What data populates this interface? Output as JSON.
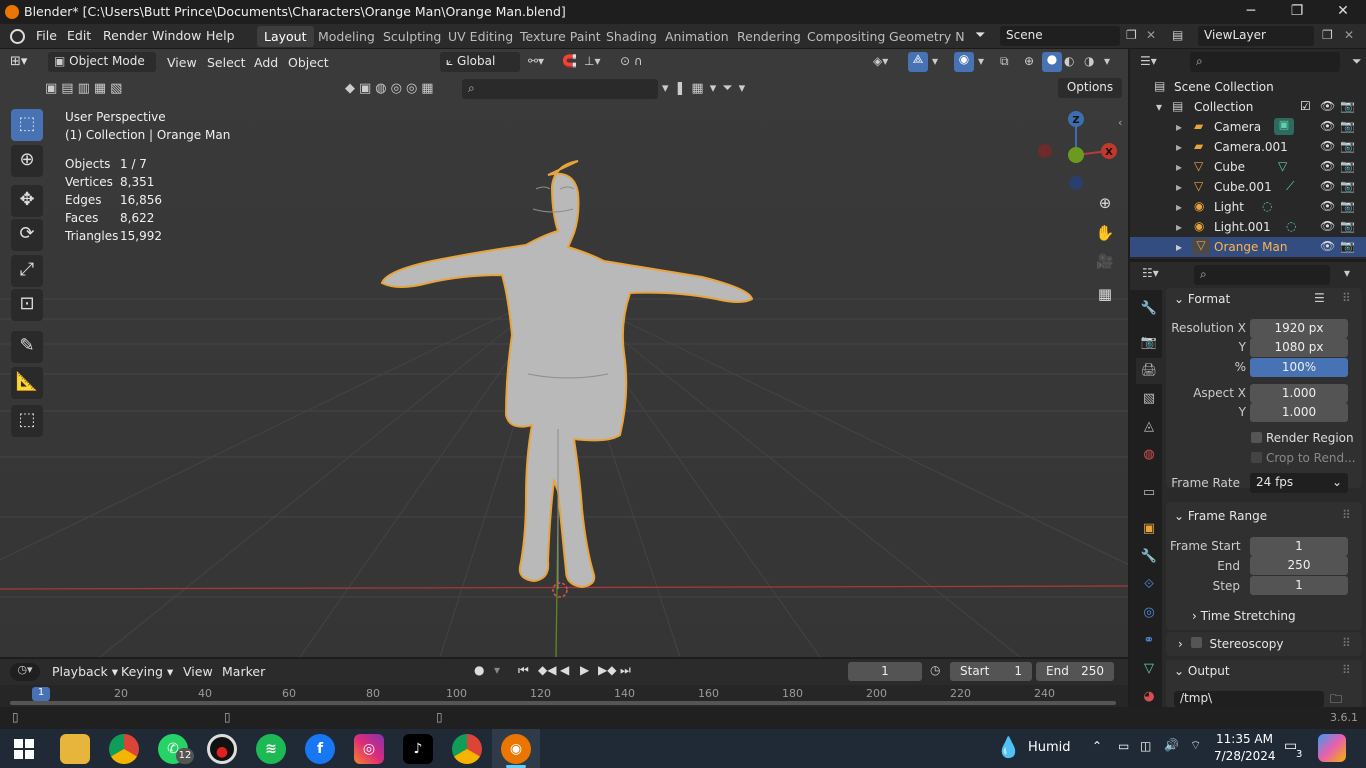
{
  "window": {
    "title": "Blender* [C:\\Users\\Butt Prince\\Documents\\Characters\\Orange Man\\Orange Man.blend]",
    "minimize": "─",
    "maximize": "❐",
    "close": "✕"
  },
  "menu": {
    "items": [
      "File",
      "Edit",
      "Render",
      "Window",
      "Help"
    ],
    "workspaces": [
      "Layout",
      "Modeling",
      "Sculpting",
      "UV Editing",
      "Texture Paint",
      "Shading",
      "Animation",
      "Rendering",
      "Compositing",
      "Geometry Noc"
    ],
    "active_workspace": "Layout",
    "scene": "Scene",
    "view_layer": "ViewLayer"
  },
  "viewport_header": {
    "mode": "Object Mode",
    "menus": [
      "View",
      "Select",
      "Add",
      "Object"
    ],
    "orientation": "Global",
    "options": "Options"
  },
  "overlay": {
    "perspective": "User Perspective",
    "collection": "(1) Collection | Orange Man",
    "stats": [
      {
        "label": "Objects",
        "value": "1 / 7"
      },
      {
        "label": "Vertices",
        "value": "8,351"
      },
      {
        "label": "Edges",
        "value": "16,856"
      },
      {
        "label": "Faces",
        "value": "8,622"
      },
      {
        "label": "Triangles",
        "value": "15,992"
      }
    ]
  },
  "gizmo": {
    "z": "Z",
    "x": "X"
  },
  "outliner": {
    "root": "Scene Collection",
    "collection": "Collection",
    "objects": [
      "Camera",
      "Camera.001",
      "Cube",
      "Cube.001",
      "Light",
      "Light.001",
      "Orange Man"
    ],
    "selected": "Orange Man"
  },
  "properties": {
    "format_title": "Format",
    "resolution_x_label": "Resolution X",
    "resolution_x": "1920 px",
    "y_label": "Y",
    "resolution_y": "1080 px",
    "percent_label": "%",
    "percent": "100%",
    "aspect_x_label": "Aspect X",
    "aspect_x": "1.000",
    "aspect_y": "1.000",
    "render_region": "Render Region",
    "crop": "Crop to Rend...",
    "frame_rate_label": "Frame Rate",
    "frame_rate": "24 fps",
    "frame_range_title": "Frame Range",
    "frame_start_label": "Frame Start",
    "frame_start": "1",
    "end_label": "End",
    "frame_end": "250",
    "step_label": "Step",
    "step": "1",
    "time_stretching": "Time Stretching",
    "stereoscopy": "Stereoscopy",
    "output_title": "Output",
    "output_path": "/tmp\\"
  },
  "timeline": {
    "menus": [
      "Playback",
      "Keying",
      "View",
      "Marker"
    ],
    "current_frame": "1",
    "start_label": "Start",
    "start": "1",
    "end_label": "End",
    "end": "250",
    "ticks": [
      "1",
      "20",
      "40",
      "60",
      "80",
      "100",
      "120",
      "140",
      "160",
      "180",
      "200",
      "220",
      "240"
    ]
  },
  "status": {
    "version": "3.6.1"
  },
  "taskbar": {
    "weather": "Humid",
    "time": "11:35 AM",
    "date": "7/28/2024",
    "whatsapp_badge": "12",
    "notif_badge": "3"
  },
  "colors": {
    "accent": "#4772b3",
    "selection": "#e8a43c",
    "axis_x": "#c0392b",
    "axis_y": "#4e9a06"
  }
}
